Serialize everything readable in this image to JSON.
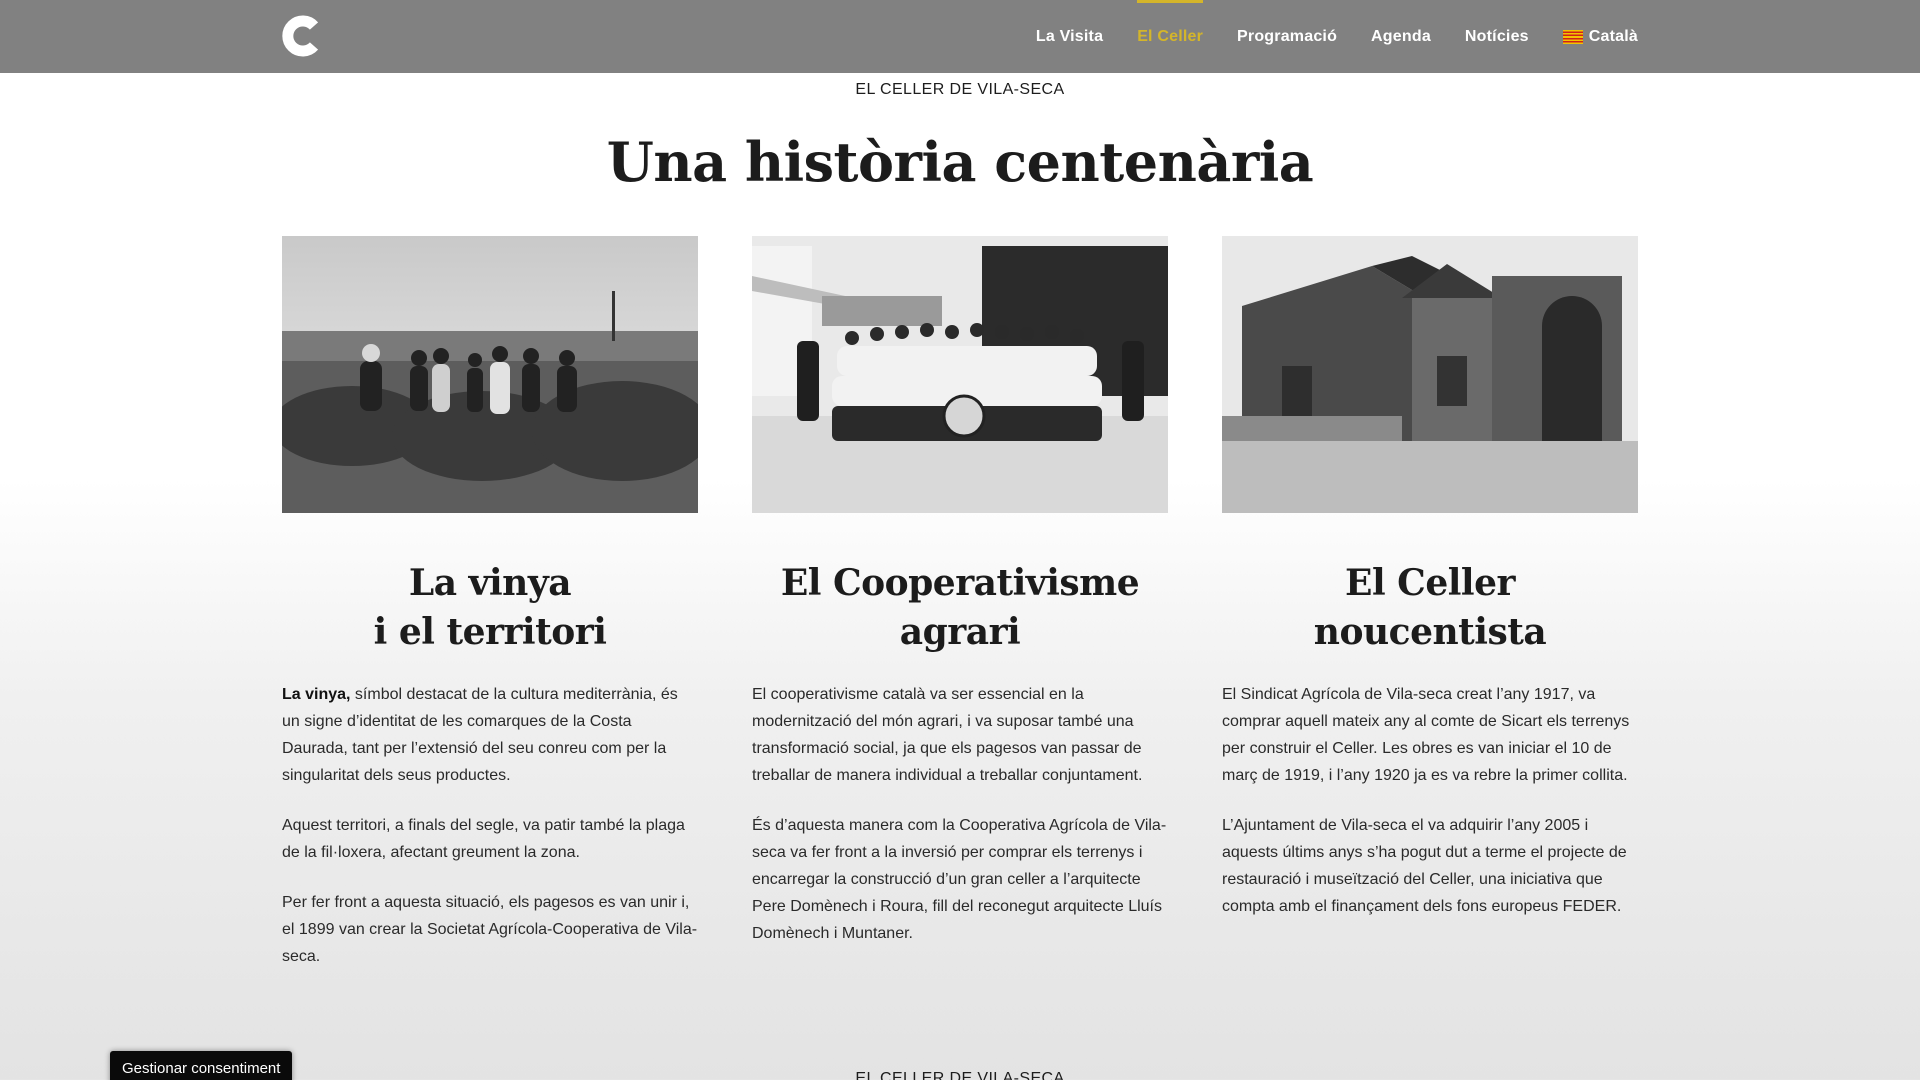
{
  "header": {
    "logo_alt": "C",
    "nav": [
      {
        "label": "La Visita",
        "active": false
      },
      {
        "label": "El Celler",
        "active": true
      },
      {
        "label": "Programació",
        "active": false
      },
      {
        "label": "Agenda",
        "active": false
      },
      {
        "label": "Notícies",
        "active": false
      },
      {
        "label": "Català",
        "active": false,
        "icon": "catalan-flag-icon"
      }
    ],
    "colors": {
      "bar": "#818181",
      "accent": "#d4b52a"
    }
  },
  "section": {
    "eyebrow": "EL CELLER DE VILA-SECA",
    "title": "Una història centenària"
  },
  "columns": [
    {
      "photo": "vineyard-workers-photo",
      "title_lines": [
        "La vinya",
        "i el territori"
      ],
      "paragraphs": [
        {
          "bold": "La vinya,",
          "text": " símbol destacat de la cultura mediterrània, és un signe d’identitat de les comarques de la Costa Daurada, tant per l’extensió del seu conreu com per la singularitat dels seus productes."
        },
        {
          "bold": "",
          "text": "Aquest territori, a finals del segle, va patir també la plaga de la fil·loxera, afectant greument la zona."
        },
        {
          "bold": "",
          "text": "Per fer front a aquesta situació, els pagesos es van unir i, el 1899 van crear la Societat Agrícola-Cooperativa de Vila-seca."
        }
      ]
    },
    {
      "photo": "cooperative-group-photo",
      "title_lines": [
        "El Cooperativisme",
        "agrari"
      ],
      "paragraphs": [
        {
          "bold": "",
          "text": "El cooperativisme català va ser essencial en la modernització del món agrari, i va suposar també una transformació social, ja que els pagesos van passar de treballar de manera individual a treballar conjuntament."
        },
        {
          "bold": "",
          "text": "És d’aquesta manera com la Cooperativa Agrícola de Vila-seca va fer front a la inversió per comprar els terrenys i encarregar la construcció d’un gran celler a l’arquitecte Pere Domènech i Roura, fill del reconegut arquitecte Lluís Domènech i Muntaner."
        }
      ]
    },
    {
      "photo": "celler-building-photo",
      "title_lines": [
        "El Celler",
        "noucentista"
      ],
      "paragraphs": [
        {
          "bold": "",
          "text": "El Sindicat Agrícola de Vila-seca creat l’any 1917, va comprar aquell mateix any al comte de Sicart els terrenys per construir el Celler. Les obres es van iniciar el 10 de març de 1919, i l’any 1920 ja es va rebre la primer collita."
        },
        {
          "bold": "",
          "text": "L’Ajuntament de Vila-seca el va adquirir l’any 2005 i aquests últims anys s’ha pogut dut a terme el projecte de restauració i museïtzació del Celler, una iniciativa que compta amb el finançament dels fons europeus FEDER."
        }
      ]
    }
  ],
  "next_section": {
    "eyebrow": "EL CELLER DE VILA-SECA"
  },
  "consent": {
    "label": "Gestionar consentiment"
  }
}
